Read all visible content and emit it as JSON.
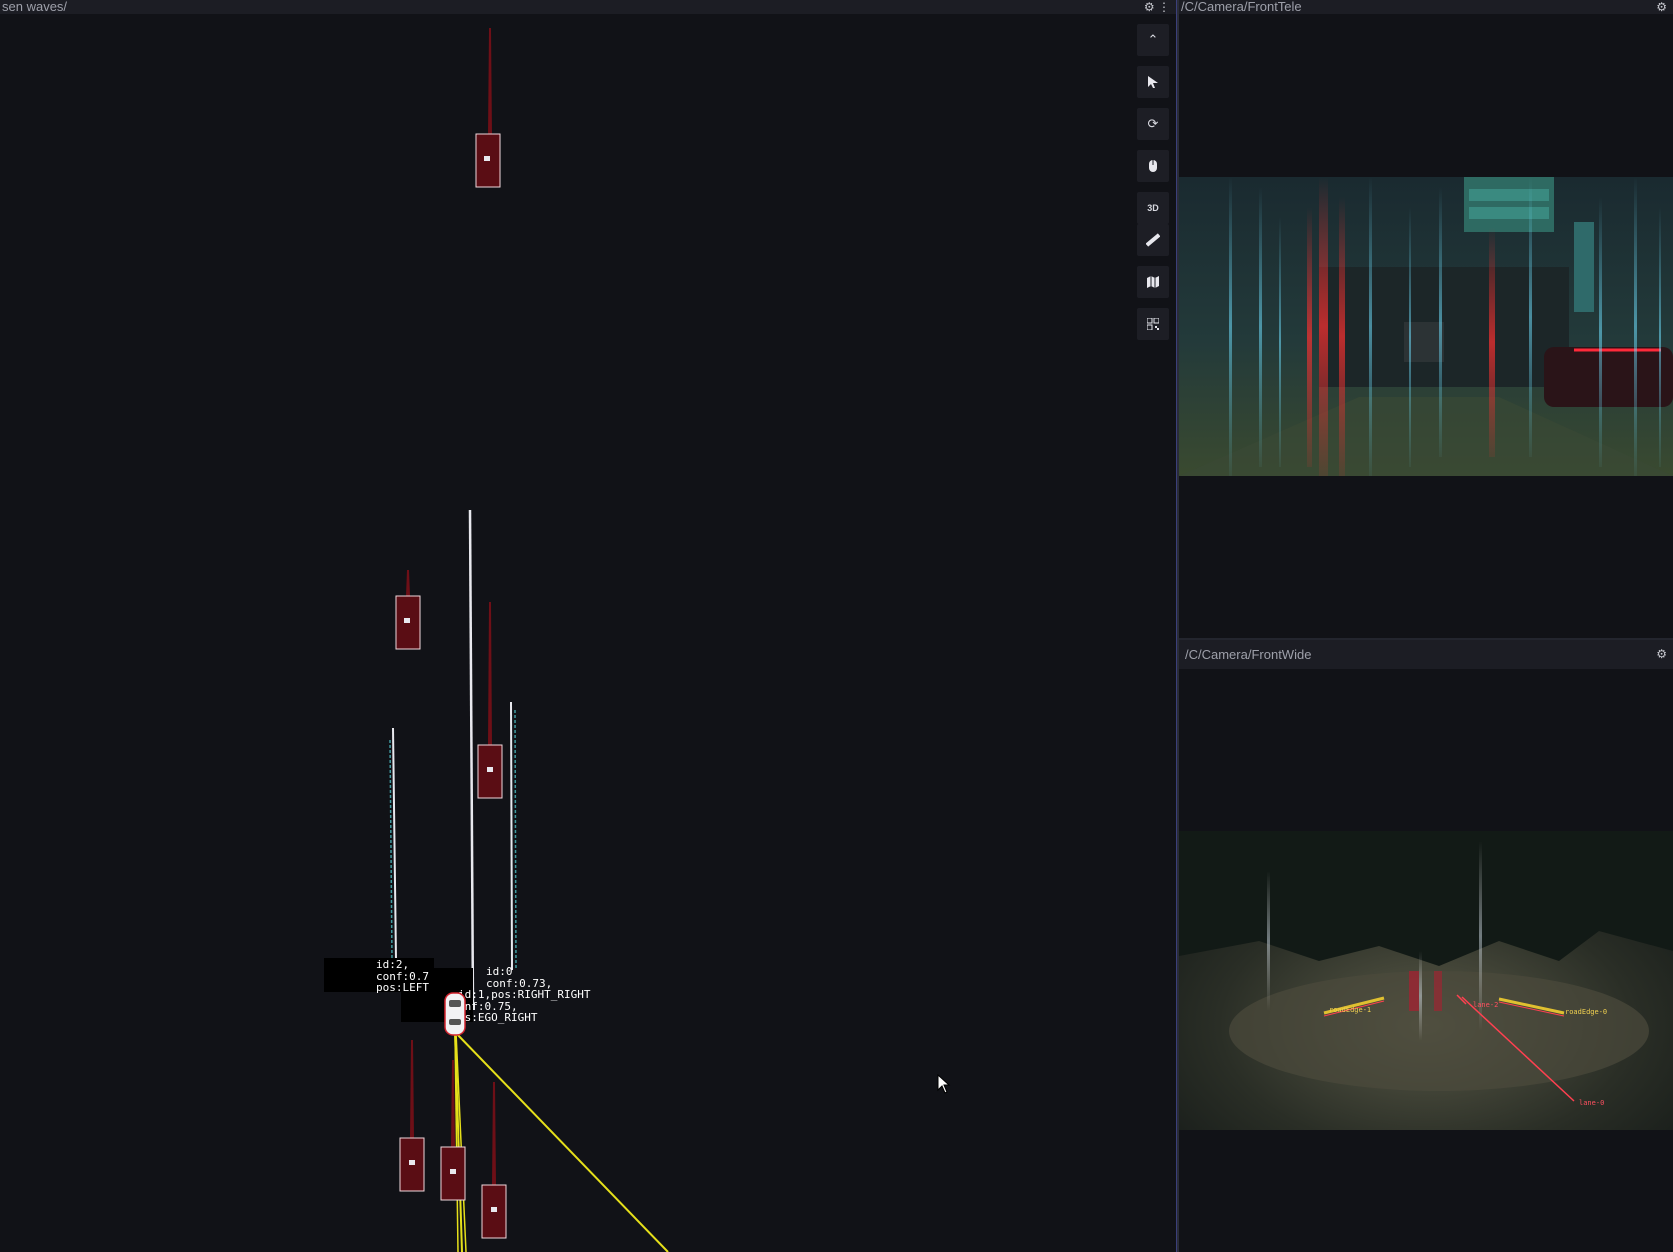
{
  "left_panel": {
    "title": "sen waves/"
  },
  "right_top_panel": {
    "title": "/C/Camera/FrontTele"
  },
  "right_bottom_panel": {
    "title": "/C/Camera/FrontWide"
  },
  "toolbar": {
    "buttons": [
      {
        "name": "collapse",
        "icon": "chevron-up-icon",
        "glyph": "⌃"
      },
      {
        "name": "select",
        "icon": "cursor-icon",
        "glyph": "➤"
      },
      {
        "name": "reset-view",
        "icon": "refresh-icon",
        "glyph": "⟳"
      },
      {
        "name": "mouse",
        "icon": "mouse-icon",
        "glyph": "▮"
      },
      {
        "name": "3d",
        "icon": "3d-icon",
        "glyph": "3D"
      },
      {
        "name": "measure",
        "icon": "ruler-icon",
        "glyph": "📏"
      },
      {
        "name": "map",
        "icon": "map-icon",
        "glyph": "▤"
      },
      {
        "name": "grid",
        "icon": "grid-icon",
        "glyph": "▦"
      }
    ]
  },
  "labels": {
    "lane_left": {
      "id": "id:2,",
      "conf": "conf:0.7",
      "pos": "pos:LEFT"
    },
    "lane_right_right": {
      "id": "id:0",
      "conf": "conf:0.73,",
      "pos": "id:1,pos:RIGHT_RIGHT"
    },
    "lane_ego_right": {
      "conf": "onf:0.75,",
      "pos": "os:EGO_RIGHT"
    }
  },
  "camera_labels": {
    "road_edge_1": "roadEdge-1",
    "road_edge_0": "roadEdge-0",
    "lane_2": "lane-2",
    "lane_0": "lane-0"
  },
  "colors": {
    "background": "#111217",
    "toolbar_bg": "#1d1e25",
    "vehicle_fill": "#6e0f17",
    "lane_white": "#e8e8ee",
    "lane_teal": "#3f9aa0",
    "trajectory_yellow": "#e6e01a"
  }
}
